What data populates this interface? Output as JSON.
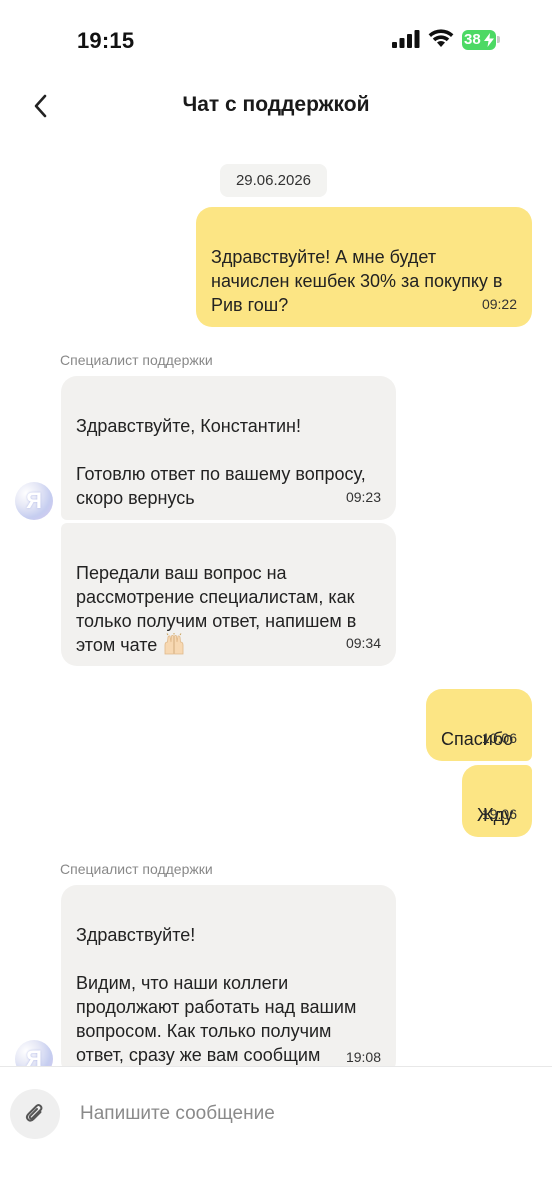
{
  "status_bar": {
    "time": "19:15",
    "battery_level": "38",
    "battery_color": "#4cd964"
  },
  "header": {
    "title": "Чат с поддержкой",
    "back_icon": "chevron-left-icon"
  },
  "chat": {
    "date": "29.06.2026",
    "sender_name": "Специалист поддержки",
    "avatar_letter": "Я",
    "messages": [
      {
        "direction": "outgoing",
        "text": "Здравствуйте! А мне будет\nначислен кешбек 30% за покупку в\nРив гош?",
        "time": "09:22"
      },
      {
        "direction": "incoming",
        "text": "Здравствуйте, Константин!\n\nГотовлю ответ по вашему вопросу,\nскоро вернусь",
        "time": "09:23"
      },
      {
        "direction": "incoming",
        "text": "Передали ваш вопрос на\nрассмотрение специалистам, как\nтолько получим ответ, напишем в\nэтом чате",
        "emoji": "raising-hands-icon",
        "time": "09:34"
      },
      {
        "direction": "outgoing",
        "text": "Спасибо",
        "time": "10:06"
      },
      {
        "direction": "outgoing",
        "text": "Жду",
        "time": "19:06"
      },
      {
        "direction": "incoming",
        "text": "Здравствуйте!\n\nВидим, что наши коллеги\nпродолжают работать над вашим\nвопросом. Как только получим\nответ, сразу же вам сообщим",
        "time": "19:08"
      }
    ]
  },
  "composer": {
    "placeholder": "Напишите сообщение",
    "attach_icon": "paperclip-icon"
  },
  "colors": {
    "outgoing_bubble": "#fce584",
    "incoming_bubble": "#f2f1ef"
  }
}
